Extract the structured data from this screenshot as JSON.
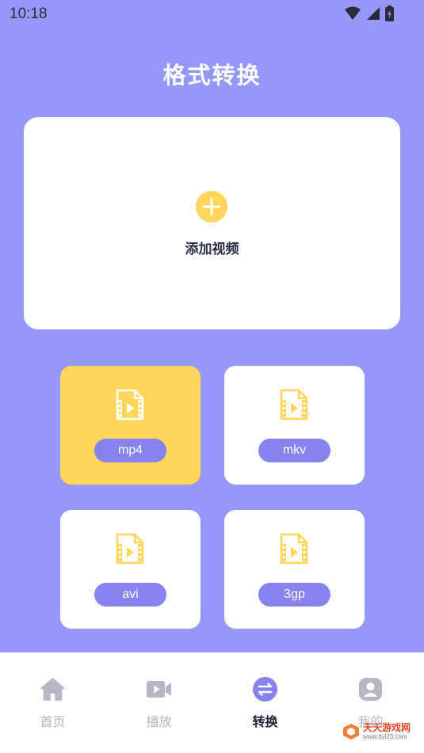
{
  "status_bar": {
    "time": "10:18"
  },
  "header": {
    "title": "格式转换"
  },
  "add_video": {
    "label": "添加视频"
  },
  "formats": [
    {
      "label": "mp4",
      "selected": true
    },
    {
      "label": "mkv",
      "selected": false
    },
    {
      "label": "avi",
      "selected": false
    },
    {
      "label": "3gp",
      "selected": false
    }
  ],
  "nav": [
    {
      "label": "首页",
      "icon": "home-icon",
      "active": false
    },
    {
      "label": "播放",
      "icon": "video-camera-icon",
      "active": false
    },
    {
      "label": "转换",
      "icon": "convert-icon",
      "active": true
    },
    {
      "label": "我的",
      "icon": "profile-icon",
      "active": false
    }
  ],
  "watermark": {
    "text": "天天游戏网",
    "url": "www.ttyl23.com"
  },
  "colors": {
    "background": "#9698F7",
    "accent_yellow": "#FFD55A",
    "pill_purple": "#8683F0",
    "nav_inactive": "#B6B6C4"
  }
}
